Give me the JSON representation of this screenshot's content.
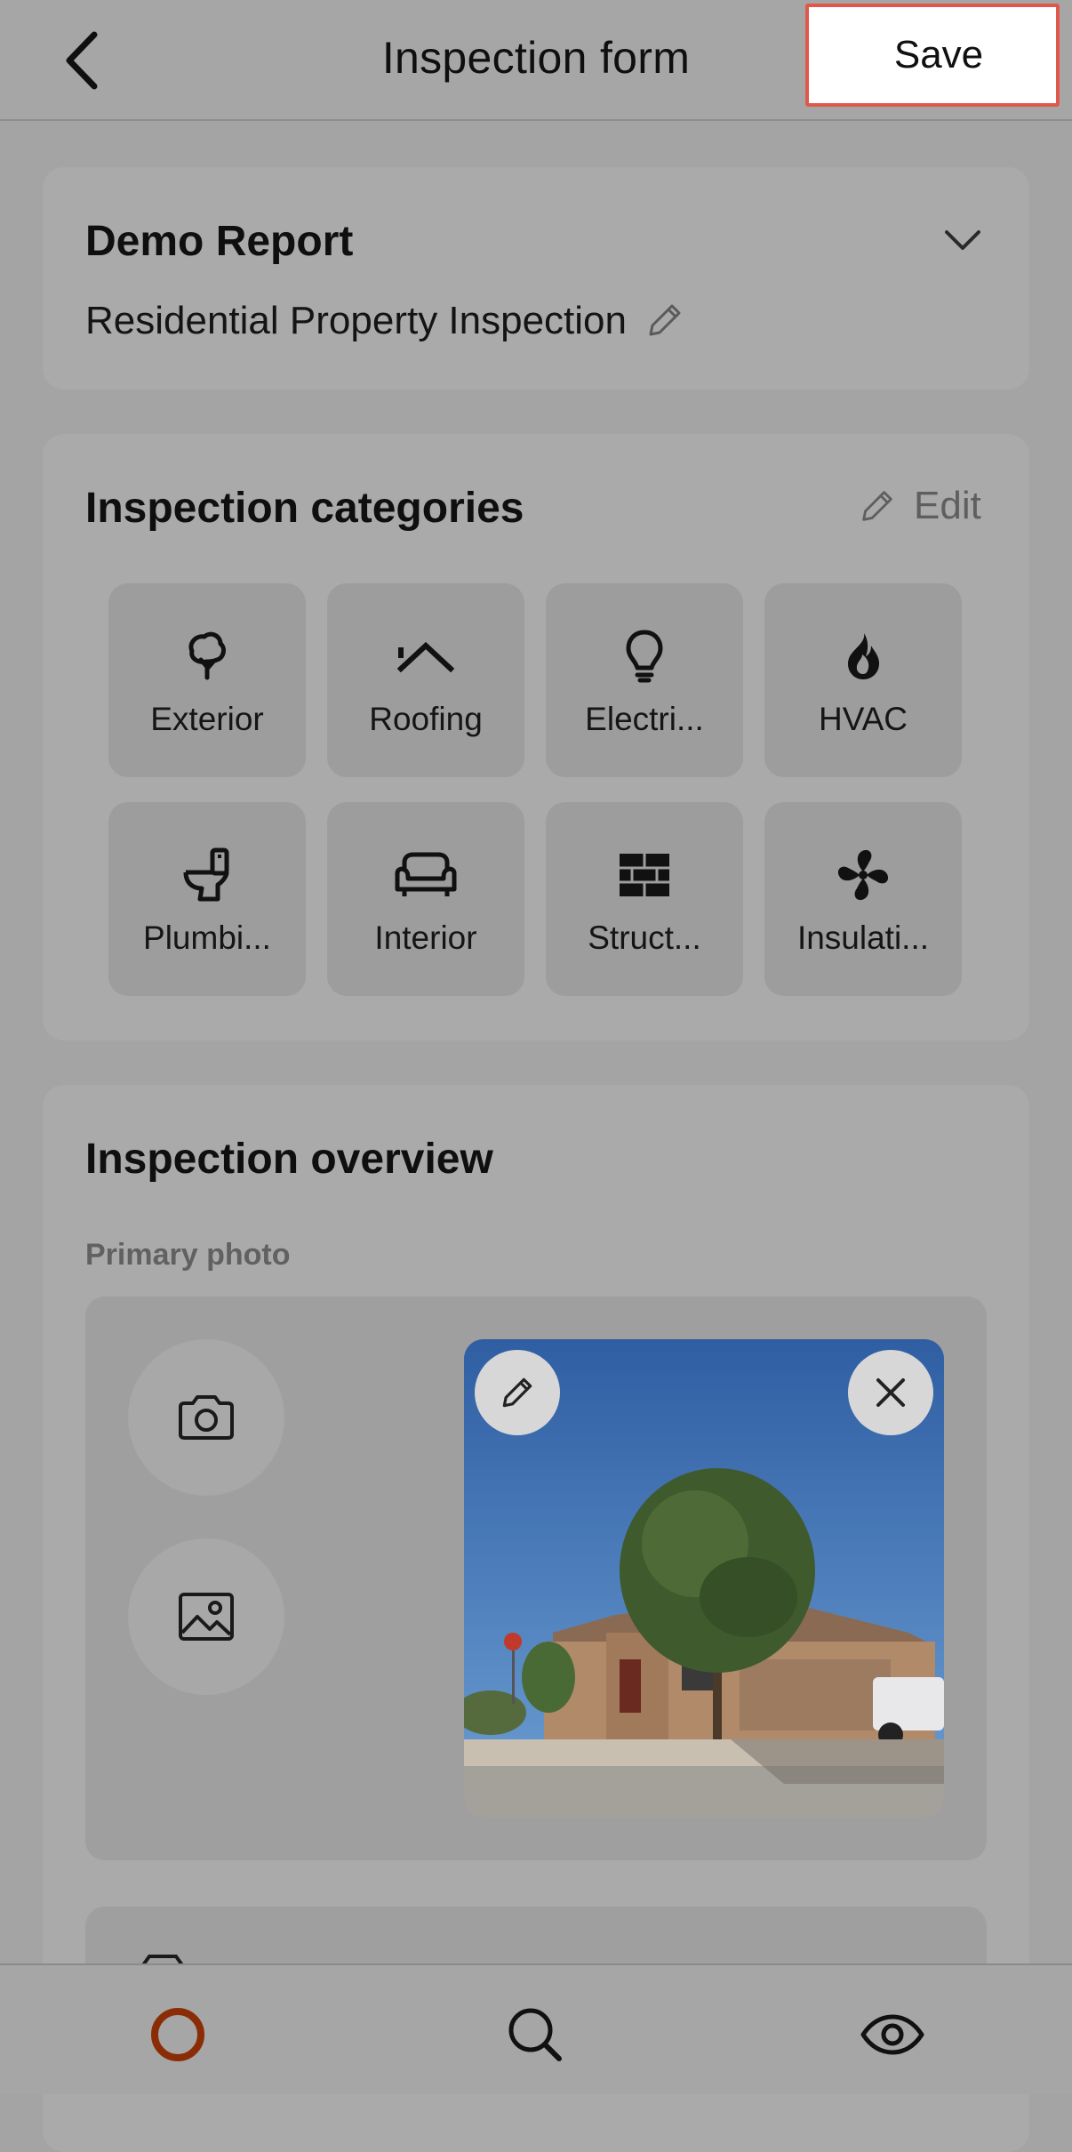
{
  "header": {
    "title": "Inspection form",
    "save_label": "Save",
    "back_icon": "chevron-left-icon"
  },
  "report": {
    "name": "Demo Report",
    "type": "Residential Property Inspection"
  },
  "categories": {
    "title": "Inspection categories",
    "edit_label": "Edit",
    "items": [
      {
        "label": "Exterior",
        "icon": "tree-icon"
      },
      {
        "label": "Roofing",
        "icon": "roof-icon"
      },
      {
        "label": "Electri...",
        "icon": "lightbulb-icon"
      },
      {
        "label": "HVAC",
        "icon": "flame-icon"
      },
      {
        "label": "Plumbi...",
        "icon": "toilet-icon"
      },
      {
        "label": "Interior",
        "icon": "sofa-icon"
      },
      {
        "label": "Struct...",
        "icon": "bricks-icon"
      },
      {
        "label": "Insulati...",
        "icon": "fan-icon"
      }
    ]
  },
  "overview": {
    "title": "Inspection overview",
    "primary_photo_label": "Primary photo"
  },
  "nav": {
    "items": [
      "home-icon",
      "search-icon",
      "eye-icon"
    ],
    "accent": "#8a2c06"
  }
}
